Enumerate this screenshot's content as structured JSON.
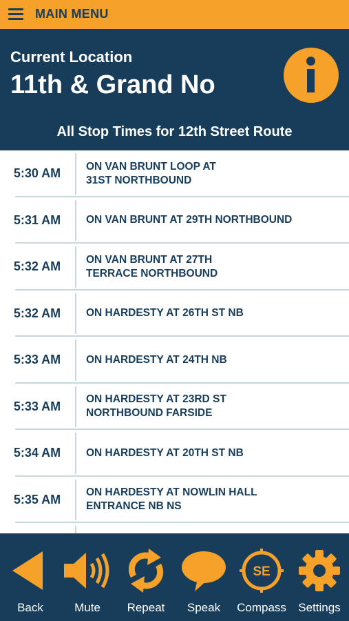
{
  "menu": {
    "label": "MAIN MENU"
  },
  "header": {
    "location_label": "Current Location",
    "location_name": "11th & Grand No",
    "route_title": "All Stop Times for 12th Street Route"
  },
  "stops": [
    {
      "time": "5:30 AM",
      "line1": "ON VAN BRUNT LOOP AT",
      "line2": "31ST NORTHBOUND"
    },
    {
      "time": "5:31 AM",
      "line1": "ON VAN BRUNT AT 29TH NORTHBOUND",
      "line2": ""
    },
    {
      "time": "5:32 AM",
      "line1": "ON VAN BRUNT AT 27TH",
      "line2": "TERRACE NORTHBOUND"
    },
    {
      "time": "5:32 AM",
      "line1": "ON HARDESTY AT 26TH ST NB",
      "line2": ""
    },
    {
      "time": "5:33 AM",
      "line1": "ON HARDESTY AT 24TH NB",
      "line2": ""
    },
    {
      "time": "5:33 AM",
      "line1": "ON HARDESTY AT 23RD ST",
      "line2": "NORTHBOUND FARSIDE"
    },
    {
      "time": "5:34 AM",
      "line1": "ON HARDESTY AT 20TH ST NB",
      "line2": ""
    },
    {
      "time": "5:35 AM",
      "line1": "ON HARDESTY AT NOWLIN HALL",
      "line2": "ENTRANCE NB NS"
    }
  ],
  "footer": {
    "back": "Back",
    "mute": "Mute",
    "repeat": "Repeat",
    "speak": "Speak",
    "compass": "Compass",
    "compass_dir": "SE",
    "settings": "Settings"
  },
  "colors": {
    "accent": "#f5a12a",
    "navy": "#173d5b",
    "divider": "#c9d6dc"
  },
  "icons": [
    "menu-icon",
    "info-icon",
    "back-arrow-icon",
    "speaker-icon",
    "repeat-icon",
    "speech-bubble-icon",
    "compass-icon",
    "gear-icon"
  ]
}
